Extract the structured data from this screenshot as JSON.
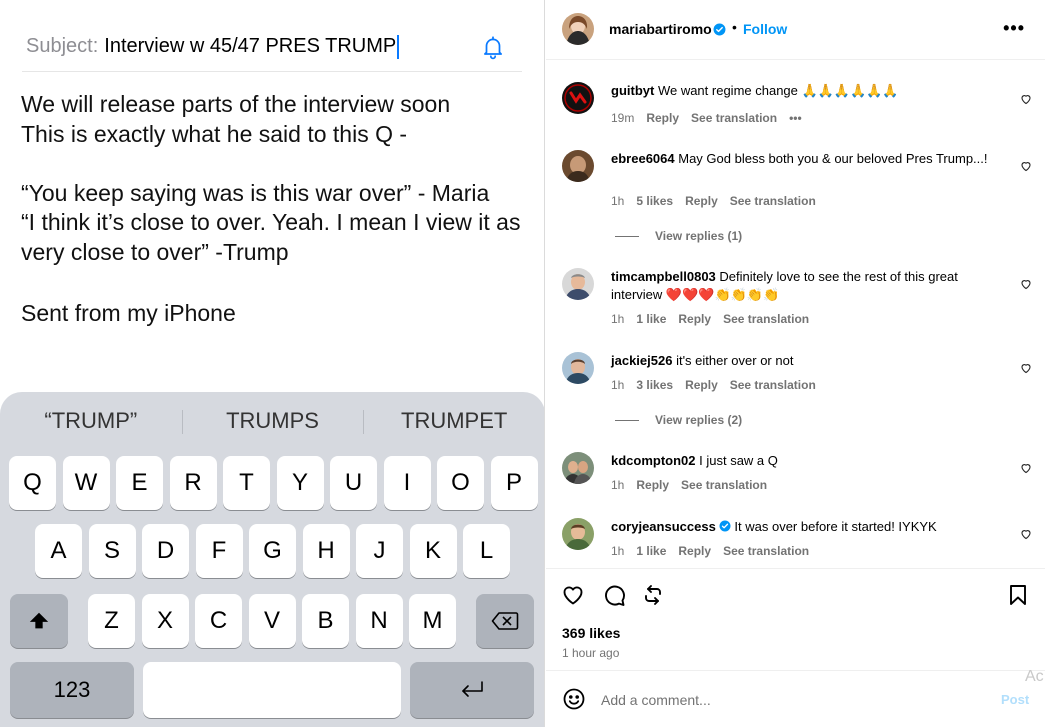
{
  "email": {
    "subject_label": "Subject:",
    "subject_value": "Interview w 45/47 PRES TRUMP",
    "body_lines": [
      "We will release parts of the interview soon",
      "This is exactly what he said to this Q -",
      "",
      "“You keep saying was is this war over” - Maria",
      "“I think it’s close to over. Yeah. I mean I view it as",
      "very close to over” -Trump",
      "",
      "Sent from my iPhone"
    ]
  },
  "keyboard": {
    "suggestions": [
      "“TRUMP”",
      "TRUMPS",
      "TRUMPET"
    ],
    "row1": [
      "Q",
      "W",
      "E",
      "R",
      "T",
      "Y",
      "U",
      "I",
      "O",
      "P"
    ],
    "row2": [
      "A",
      "S",
      "D",
      "F",
      "G",
      "H",
      "J",
      "K",
      "L"
    ],
    "row3": [
      "Z",
      "X",
      "C",
      "V",
      "B",
      "N",
      "M"
    ],
    "numbers_label": "123"
  },
  "post": {
    "username": "mariabartiromo",
    "dot": "•",
    "follow_label": "Follow",
    "more_label": "•••",
    "likes": "369 likes",
    "time_ago": "1 hour ago",
    "comment_placeholder": "Add a comment...",
    "post_label": "Post",
    "watermark": "Ac"
  },
  "comments": [
    {
      "user": "guitbyt",
      "text": " We want regime change 🙏🙏🙏🙏🙏🙏",
      "time": "19m",
      "likes": "",
      "reply": "Reply",
      "translation": "See translation",
      "more": "•••",
      "view_replies": ""
    },
    {
      "user": "ebree6064",
      "text": " May God bless both you & our beloved Pres Trump...!",
      "time": "1h",
      "likes": "5 likes",
      "reply": "Reply",
      "translation": "See translation",
      "more": "",
      "view_replies": "View replies (1)"
    },
    {
      "user": "timcampbell0803",
      "text": " Definitely love to see the rest of this great interview ❤️❤️❤️👏👏👏👏",
      "time": "1h",
      "likes": "1 like",
      "reply": "Reply",
      "translation": "See translation",
      "more": "",
      "view_replies": ""
    },
    {
      "user": "jackiej526",
      "text": " it's either over or not",
      "time": "1h",
      "likes": "3 likes",
      "reply": "Reply",
      "translation": "See translation",
      "more": "",
      "view_replies": "View replies (2)"
    },
    {
      "user": "kdcompton02",
      "text": " I just saw a Q",
      "time": "1h",
      "likes": "",
      "reply": "Reply",
      "translation": "See translation",
      "more": "",
      "view_replies": ""
    },
    {
      "user": "coryjeansuccess",
      "text": " It was over before it started! IYKYK",
      "time": "1h",
      "likes": "1 like",
      "reply": "Reply",
      "translation": "See translation",
      "more": "",
      "view_replies": ""
    }
  ],
  "colors": {
    "link_blue": "#0095f6",
    "ios_blue": "#0a7aff",
    "meta_gray": "#737373",
    "keyboard_bg": "#d6d9df"
  },
  "icons": [
    "bell-icon",
    "verified-icon",
    "heart-icon",
    "comment-icon",
    "repost-icon",
    "bookmark-icon",
    "emoji-icon",
    "shift-icon",
    "backspace-icon",
    "return-icon"
  ]
}
